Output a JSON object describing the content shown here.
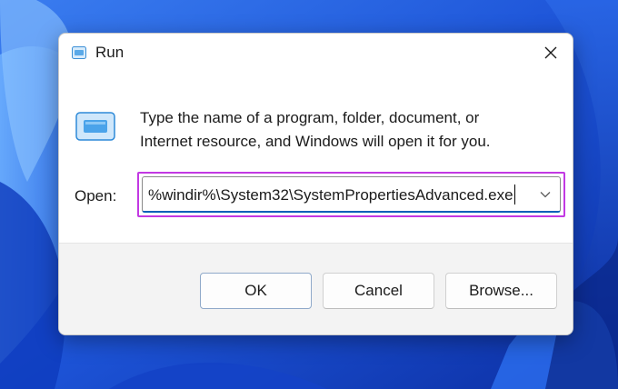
{
  "window": {
    "title": "Run"
  },
  "message": {
    "line1": "Type the name of a program, folder, document, or",
    "line2": "Internet resource, and Windows will open it for you."
  },
  "open": {
    "label": "Open:",
    "value": "%windir%\\System32\\SystemPropertiesAdvanced.exe"
  },
  "buttons": {
    "ok": "OK",
    "cancel": "Cancel",
    "browse": "Browse..."
  },
  "icons": {
    "app": "run-icon",
    "close": "close-icon",
    "dropdown": "chevron-down-icon"
  },
  "colors": {
    "highlight": "#c239e3",
    "input_focus": "#005fb8",
    "wallpaper": "#1a4fd6"
  }
}
